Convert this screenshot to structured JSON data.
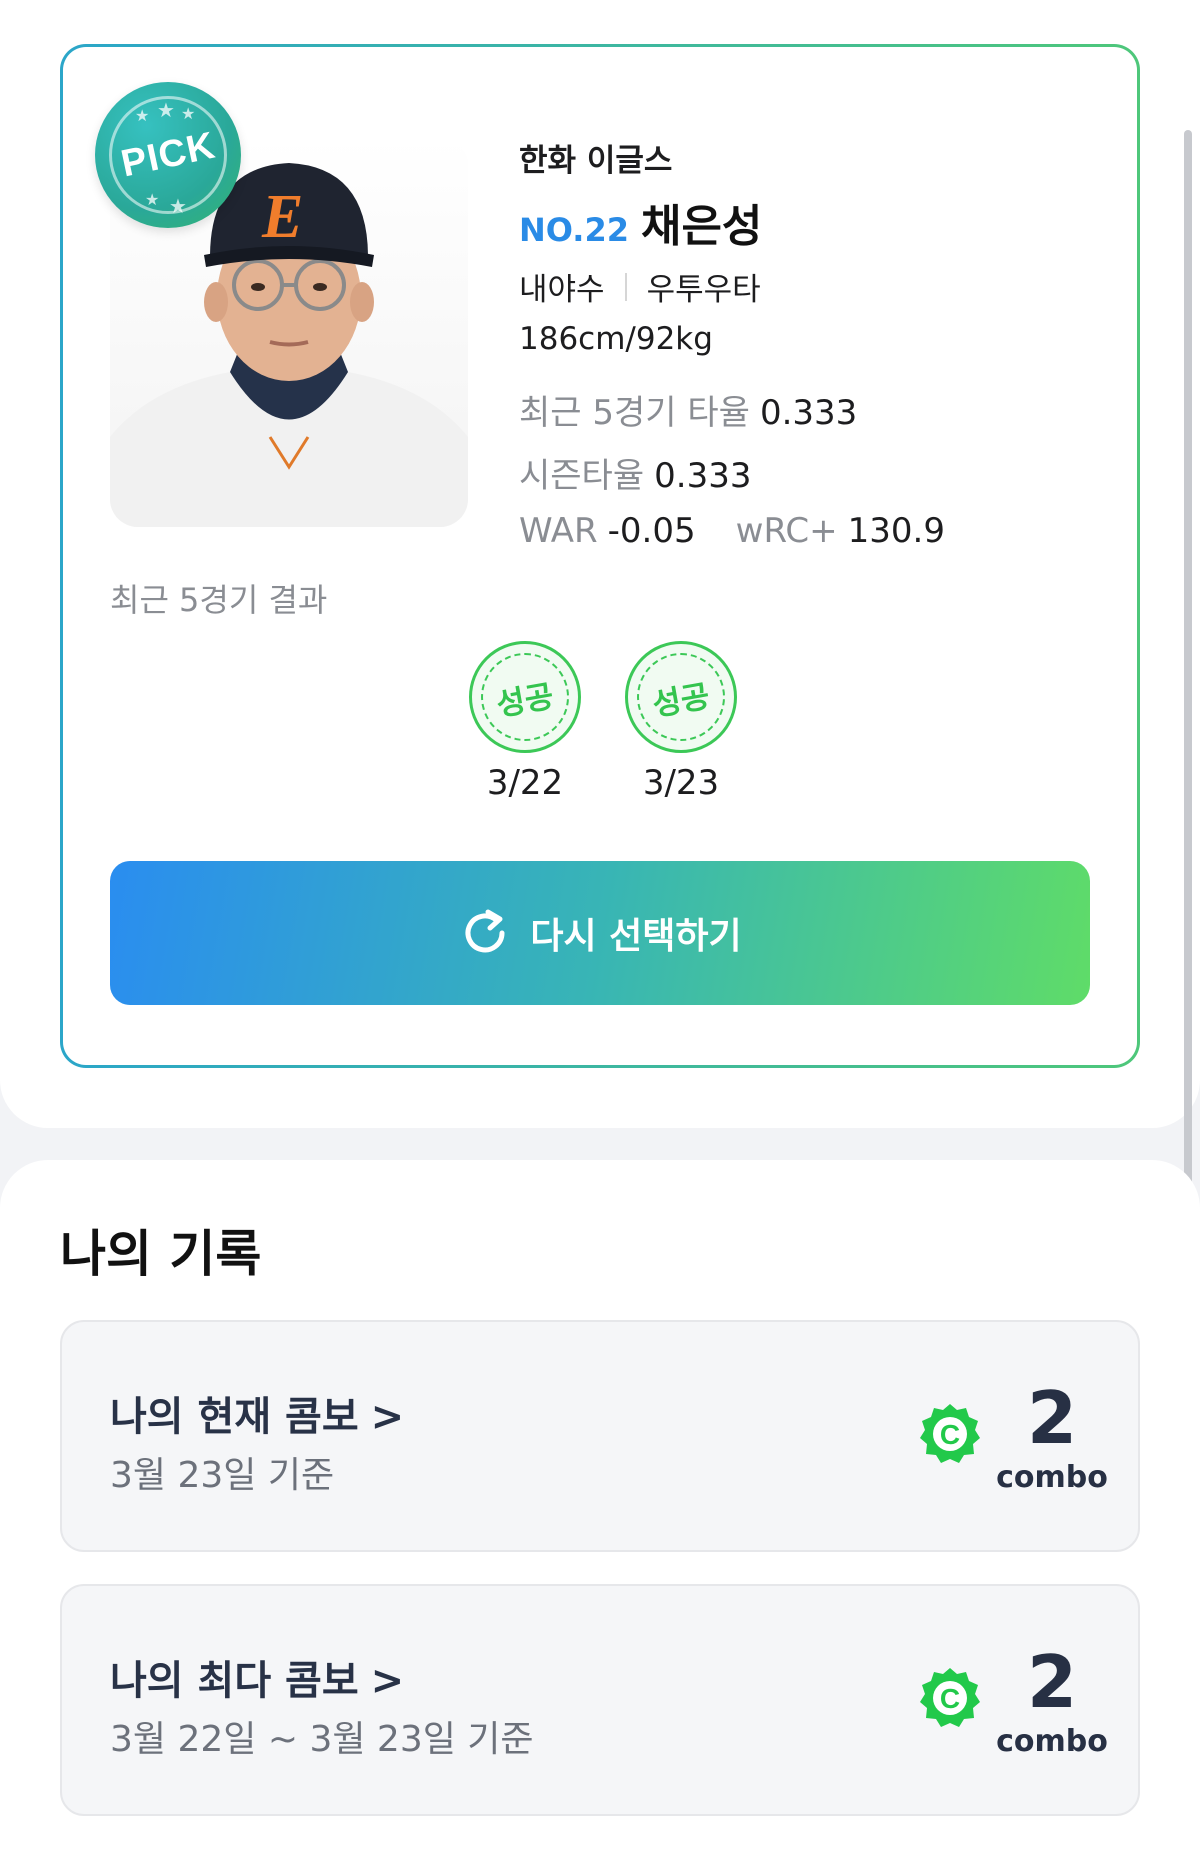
{
  "player": {
    "badge": "PICK",
    "team": "한화 이글스",
    "number": "NO.22",
    "name": "채은성",
    "position": "내야수",
    "bats_throws": "우투우타",
    "body": "186cm/92kg",
    "stats": {
      "recent5_label": "최근 5경기 타율",
      "recent5_value": "0.333",
      "season_label": "시즌타율",
      "season_value": "0.333",
      "war_label": "WAR",
      "war_value": "-0.05",
      "wrc_label": "wRC+",
      "wrc_value": "130.9"
    },
    "cap_letter": "E"
  },
  "recent_results": {
    "label": "최근 5경기 결과",
    "items": [
      {
        "result": "성공",
        "date": "3/22"
      },
      {
        "result": "성공",
        "date": "3/23"
      }
    ]
  },
  "reselect_button": {
    "label": "다시 선택하기",
    "icon": "refresh-icon"
  },
  "records": {
    "title": "나의 기록",
    "current_combo": {
      "title": "나의 현재 콤보",
      "chevron": ">",
      "subtitle": "3월 23일 기준",
      "icon_letter": "C",
      "value": "2",
      "unit": "combo"
    },
    "max_combo": {
      "title": "나의 최다 콤보",
      "chevron": ">",
      "subtitle": "3월 22일 ~ 3월 23일 기준",
      "icon_letter": "C",
      "value": "2",
      "unit": "combo"
    }
  },
  "colors": {
    "accent_blue": "#2a8be6",
    "accent_green": "#3cc857",
    "combo_green": "#22c94a"
  }
}
